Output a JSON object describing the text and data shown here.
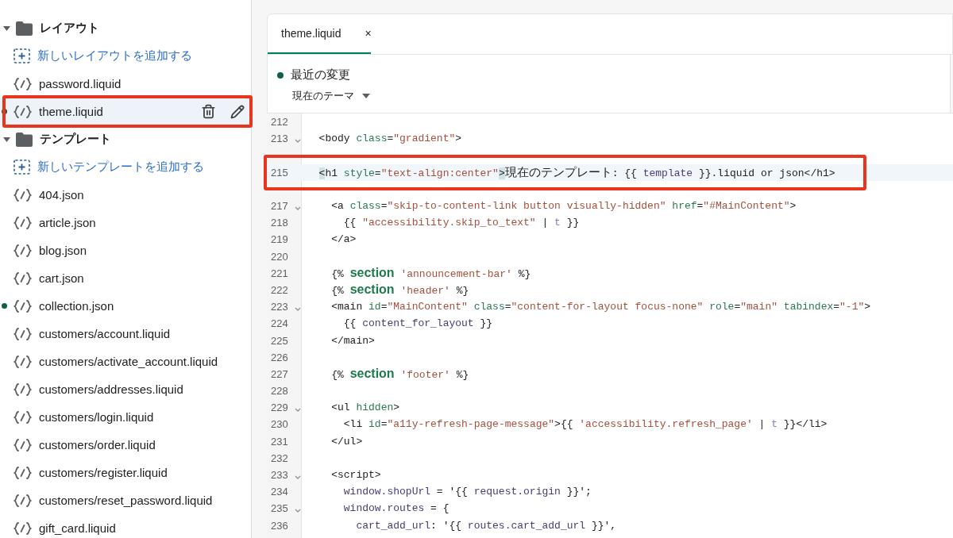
{
  "sidebar": {
    "sections": [
      {
        "name": "レイアウト",
        "expanded": true,
        "add_label": "新しいレイアウトを追加する",
        "files": [
          {
            "name": "password.liquid",
            "selected": false,
            "modified": false,
            "annotated": false
          },
          {
            "name": "theme.liquid",
            "selected": true,
            "modified": true,
            "annotated": true
          }
        ]
      },
      {
        "name": "テンプレート",
        "expanded": true,
        "add_label": "新しいテンプレートを追加する",
        "files": [
          {
            "name": "404.json",
            "selected": false,
            "modified": false,
            "annotated": false
          },
          {
            "name": "article.json",
            "selected": false,
            "modified": false,
            "annotated": false
          },
          {
            "name": "blog.json",
            "selected": false,
            "modified": false,
            "annotated": false
          },
          {
            "name": "cart.json",
            "selected": false,
            "modified": false,
            "annotated": false
          },
          {
            "name": "collection.json",
            "selected": false,
            "modified": true,
            "annotated": false
          },
          {
            "name": "customers/account.liquid",
            "selected": false,
            "modified": false,
            "annotated": false
          },
          {
            "name": "customers/activate_account.liquid",
            "selected": false,
            "modified": false,
            "annotated": false
          },
          {
            "name": "customers/addresses.liquid",
            "selected": false,
            "modified": false,
            "annotated": false
          },
          {
            "name": "customers/login.liquid",
            "selected": false,
            "modified": false,
            "annotated": false
          },
          {
            "name": "customers/order.liquid",
            "selected": false,
            "modified": false,
            "annotated": false
          },
          {
            "name": "customers/register.liquid",
            "selected": false,
            "modified": false,
            "annotated": false
          },
          {
            "name": "customers/reset_password.liquid",
            "selected": false,
            "modified": false,
            "annotated": false
          },
          {
            "name": "gift_card.liquid",
            "selected": false,
            "modified": false,
            "annotated": false
          }
        ]
      }
    ]
  },
  "editor": {
    "tabs": [
      {
        "label": "theme.liquid",
        "close": "×",
        "selected": true
      }
    ],
    "version": {
      "title": "最近の変更",
      "subtitle": "現在のテーマ"
    },
    "lines": [
      {
        "number": "212",
        "foldable": false,
        "annotated": false
      },
      {
        "number": "213",
        "foldable": true,
        "annotated": false,
        "tokens": [
          {
            "kind": "tag",
            "text": "  <body "
          },
          {
            "kind": "attr",
            "text": "class"
          },
          {
            "kind": "text",
            "text": "="
          },
          {
            "kind": "str",
            "text": "\"gradient\""
          },
          {
            "kind": "tag",
            "text": ">"
          }
        ]
      },
      {
        "number": "215",
        "foldable": false,
        "annotated": true,
        "tokens": [
          {
            "kind": "match",
            "text": "  <"
          },
          {
            "kind": "tag",
            "text": "h1 "
          },
          {
            "kind": "attr",
            "text": "style"
          },
          {
            "kind": "text",
            "text": "="
          },
          {
            "kind": "str",
            "text": "\"text-align:center\""
          },
          {
            "kind": "match",
            "text": ">"
          },
          {
            "kind": "cjk",
            "text": "現在のテンプレート"
          },
          {
            "kind": "text",
            "text": ": {{ "
          },
          {
            "kind": "var",
            "text": "template"
          },
          {
            "kind": "text",
            "text": " }}.liquid or json</h1>"
          }
        ]
      },
      {
        "number": "217",
        "foldable": true,
        "annotated": false,
        "tokens": [
          {
            "kind": "tag",
            "text": "    <a "
          },
          {
            "kind": "attr",
            "text": "class"
          },
          {
            "kind": "text",
            "text": "="
          },
          {
            "kind": "str",
            "text": "\"skip-to-content-link button visually-hidden\""
          },
          {
            "kind": "attr",
            "text": " href"
          },
          {
            "kind": "text",
            "text": "="
          },
          {
            "kind": "str",
            "text": "\"#MainContent\""
          },
          {
            "kind": "tag",
            "text": ">"
          }
        ]
      },
      {
        "number": "218",
        "foldable": false,
        "annotated": false,
        "tokens": [
          {
            "kind": "text",
            "text": "      {{ "
          },
          {
            "kind": "str",
            "text": "\"accessibility.skip_to_text\""
          },
          {
            "kind": "text",
            "text": " | "
          },
          {
            "kind": "filter",
            "text": "t"
          },
          {
            "kind": "text",
            "text": " }}"
          }
        ]
      },
      {
        "number": "219",
        "foldable": false,
        "annotated": false,
        "tokens": [
          {
            "kind": "tag",
            "text": "    </a>"
          }
        ]
      },
      {
        "number": "220",
        "foldable": false,
        "annotated": false
      },
      {
        "number": "221",
        "foldable": false,
        "annotated": false,
        "tokens": [
          {
            "kind": "text",
            "text": "    {% "
          },
          {
            "kind": "kw",
            "text": "section"
          },
          {
            "kind": "str",
            "text": " 'announcement-bar'"
          },
          {
            "kind": "text",
            "text": " %}"
          }
        ]
      },
      {
        "number": "222",
        "foldable": false,
        "annotated": false,
        "tokens": [
          {
            "kind": "text",
            "text": "    {% "
          },
          {
            "kind": "kw",
            "text": "section"
          },
          {
            "kind": "str",
            "text": " 'header'"
          },
          {
            "kind": "text",
            "text": " %}"
          }
        ]
      },
      {
        "number": "223",
        "foldable": true,
        "annotated": false,
        "tokens": [
          {
            "kind": "tag",
            "text": "    <main "
          },
          {
            "kind": "attr",
            "text": "id"
          },
          {
            "kind": "text",
            "text": "="
          },
          {
            "kind": "str",
            "text": "\"MainContent\""
          },
          {
            "kind": "attr",
            "text": " class"
          },
          {
            "kind": "text",
            "text": "="
          },
          {
            "kind": "str",
            "text": "\"content-for-layout focus-none\""
          },
          {
            "kind": "attr",
            "text": " role"
          },
          {
            "kind": "text",
            "text": "="
          },
          {
            "kind": "str",
            "text": "\"main\""
          },
          {
            "kind": "attr",
            "text": " tabindex"
          },
          {
            "kind": "text",
            "text": "="
          },
          {
            "kind": "str",
            "text": "\"-1\""
          },
          {
            "kind": "tag",
            "text": ">"
          }
        ]
      },
      {
        "number": "224",
        "foldable": false,
        "annotated": false,
        "tokens": [
          {
            "kind": "text",
            "text": "      {{ "
          },
          {
            "kind": "var",
            "text": "content_for_layout"
          },
          {
            "kind": "text",
            "text": " }}"
          }
        ]
      },
      {
        "number": "225",
        "foldable": false,
        "annotated": false,
        "tokens": [
          {
            "kind": "tag",
            "text": "    </main>"
          }
        ]
      },
      {
        "number": "226",
        "foldable": false,
        "annotated": false
      },
      {
        "number": "227",
        "foldable": false,
        "annotated": false,
        "tokens": [
          {
            "kind": "text",
            "text": "    {% "
          },
          {
            "kind": "kw",
            "text": "section"
          },
          {
            "kind": "str",
            "text": " 'footer'"
          },
          {
            "kind": "text",
            "text": " %}"
          }
        ]
      },
      {
        "number": "228",
        "foldable": false,
        "annotated": false
      },
      {
        "number": "229",
        "foldable": true,
        "annotated": false,
        "tokens": [
          {
            "kind": "tag",
            "text": "    <ul "
          },
          {
            "kind": "attr",
            "text": "hidden"
          },
          {
            "kind": "tag",
            "text": ">"
          }
        ]
      },
      {
        "number": "230",
        "foldable": false,
        "annotated": false,
        "tokens": [
          {
            "kind": "tag",
            "text": "      <li "
          },
          {
            "kind": "attr",
            "text": "id"
          },
          {
            "kind": "text",
            "text": "="
          },
          {
            "kind": "str",
            "text": "\"a11y-refresh-page-message\""
          },
          {
            "kind": "tag",
            "text": ">{{ "
          },
          {
            "kind": "str",
            "text": "'accessibility.refresh_page'"
          },
          {
            "kind": "text",
            "text": " | "
          },
          {
            "kind": "filter",
            "text": "t"
          },
          {
            "kind": "tag",
            "text": " }}</li>"
          }
        ]
      },
      {
        "number": "231",
        "foldable": false,
        "annotated": false,
        "tokens": [
          {
            "kind": "tag",
            "text": "    </ul>"
          }
        ]
      },
      {
        "number": "232",
        "foldable": false,
        "annotated": false
      },
      {
        "number": "233",
        "foldable": true,
        "annotated": false,
        "tokens": [
          {
            "kind": "tag",
            "text": "    <script>"
          }
        ]
      },
      {
        "number": "234",
        "foldable": false,
        "annotated": false,
        "tokens": [
          {
            "kind": "var",
            "text": "      window.shopUrl"
          },
          {
            "kind": "text",
            "text": " = '{{ "
          },
          {
            "kind": "var",
            "text": "request.origin"
          },
          {
            "kind": "text",
            "text": " }}';"
          }
        ]
      },
      {
        "number": "235",
        "foldable": true,
        "annotated": false,
        "tokens": [
          {
            "kind": "var",
            "text": "      window.routes"
          },
          {
            "kind": "text",
            "text": " = {"
          }
        ]
      },
      {
        "number": "236",
        "foldable": false,
        "annotated": false,
        "tokens": [
          {
            "kind": "var",
            "text": "        cart_add_url"
          },
          {
            "kind": "text",
            "text": ": '{{ "
          },
          {
            "kind": "var",
            "text": "routes.cart_add_url"
          },
          {
            "kind": "text",
            "text": " }}',"
          }
        ]
      }
    ]
  }
}
